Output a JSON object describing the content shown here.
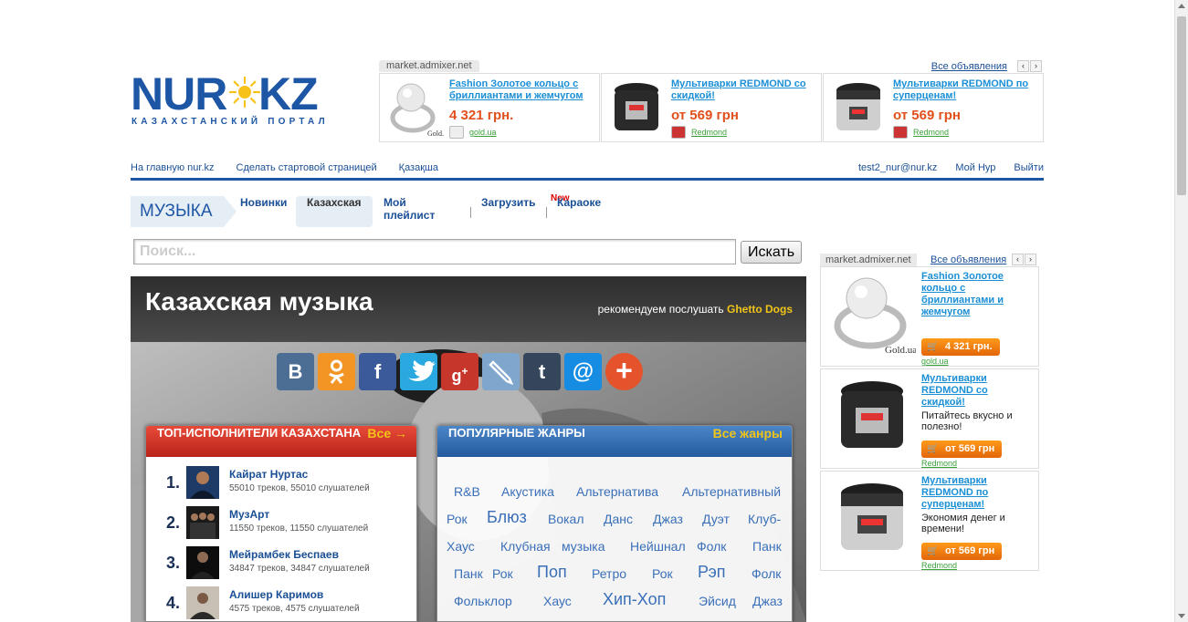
{
  "logo": {
    "left": "NUR",
    "right": "KZ",
    "tagline": "КАЗАХСТАНСКИЙ ПОРТАЛ"
  },
  "ad_top": {
    "source": "market.admixer.net",
    "all_link": "Все объявления",
    "items": [
      {
        "title": "Fashion Золотое кольцо с бриллиантами и жемчугом",
        "price": "4 321 грн.",
        "shop": "gold.ua"
      },
      {
        "title": "Мультиварки REDMOND со скидкой!",
        "price": "от 569 грн",
        "shop": "Redmond"
      },
      {
        "title": "Мультиварки REDMOND по суперценам!",
        "price": "от 569 грн",
        "shop": "Redmond"
      }
    ]
  },
  "top_nav": {
    "left": [
      "На главную nur.kz",
      "Сделать стартовой страницей",
      "Қазақша"
    ],
    "right": [
      "test2_nur@nur.kz",
      "Мой Нур",
      "Выйти"
    ]
  },
  "music_nav": {
    "section": "МУЗЫКА",
    "items": [
      "Новинки",
      "Казахская",
      "Мой плейлист",
      "Загрузить",
      "Караоке"
    ],
    "new_badge": "New"
  },
  "search": {
    "placeholder": "Поиск...",
    "button": "Искать"
  },
  "hero": {
    "title": "Казахская музыка",
    "recommend_label": "рекомендуем послушать",
    "recommend_artist": "Ghetto Dogs"
  },
  "social": [
    "vk",
    "odnoklassniki",
    "facebook",
    "twitter",
    "google-plus",
    "livejournal",
    "tumblr",
    "mail",
    "more"
  ],
  "top_artists": {
    "title": "ТОП-ИСПОЛНИТЕЛИ КАЗАХСТАНА",
    "all_link": "Все →",
    "rows": [
      {
        "num": "1.",
        "name": "Кайрат Нуртас",
        "meta": "55010 треков, 55010 слушателей"
      },
      {
        "num": "2.",
        "name": "МузАрт",
        "meta": "11550 треков, 11550 слушателей"
      },
      {
        "num": "3.",
        "name": "Мейрамбек Беспаев",
        "meta": "34847 треков, 34847 слушателей"
      },
      {
        "num": "4.",
        "name": "Алишер Каримов",
        "meta": "4575 треков, 4575 слушателей"
      }
    ]
  },
  "genres": {
    "title": "ПОПУЛЯРНЫЕ ЖАНРЫ",
    "all_link": "Все жанры",
    "tags": [
      "R&B",
      "Акустика",
      "Альтернатива",
      "Альтернативный",
      "Рок",
      "Блюз",
      "Вокал",
      "Данс",
      "Джаз",
      "Дуэт",
      "Клуб-",
      "Хаус",
      "Клубная",
      "музыка",
      "Нейшнал",
      "Фолк",
      "Панк",
      "Панк",
      "Рок",
      "Поп",
      "Ретро",
      "Рок",
      "Рэп",
      "Фолк",
      "Фольклор",
      "Хаус",
      "Хип-Хоп",
      "Эйсид",
      "Джаз"
    ]
  },
  "ad_side": {
    "source": "market.admixer.net",
    "all_link": "Все объявления",
    "cards": [
      {
        "title": "Fashion Золотое кольцо с бриллиантами и жемчугом",
        "desc": "",
        "price": "4 321 грн.",
        "shop": "gold.ua"
      },
      {
        "title": "Мультиварки REDMOND со скидкой!",
        "desc": "Питайтесь вкусно и полезно!",
        "price": "от 569 грн",
        "shop": "Redmond"
      },
      {
        "title": "Мультиварки REDMOND по суперценам!",
        "desc": "Экономия денег и времени!",
        "price": "от 569 грн",
        "shop": "Redmond"
      }
    ]
  }
}
